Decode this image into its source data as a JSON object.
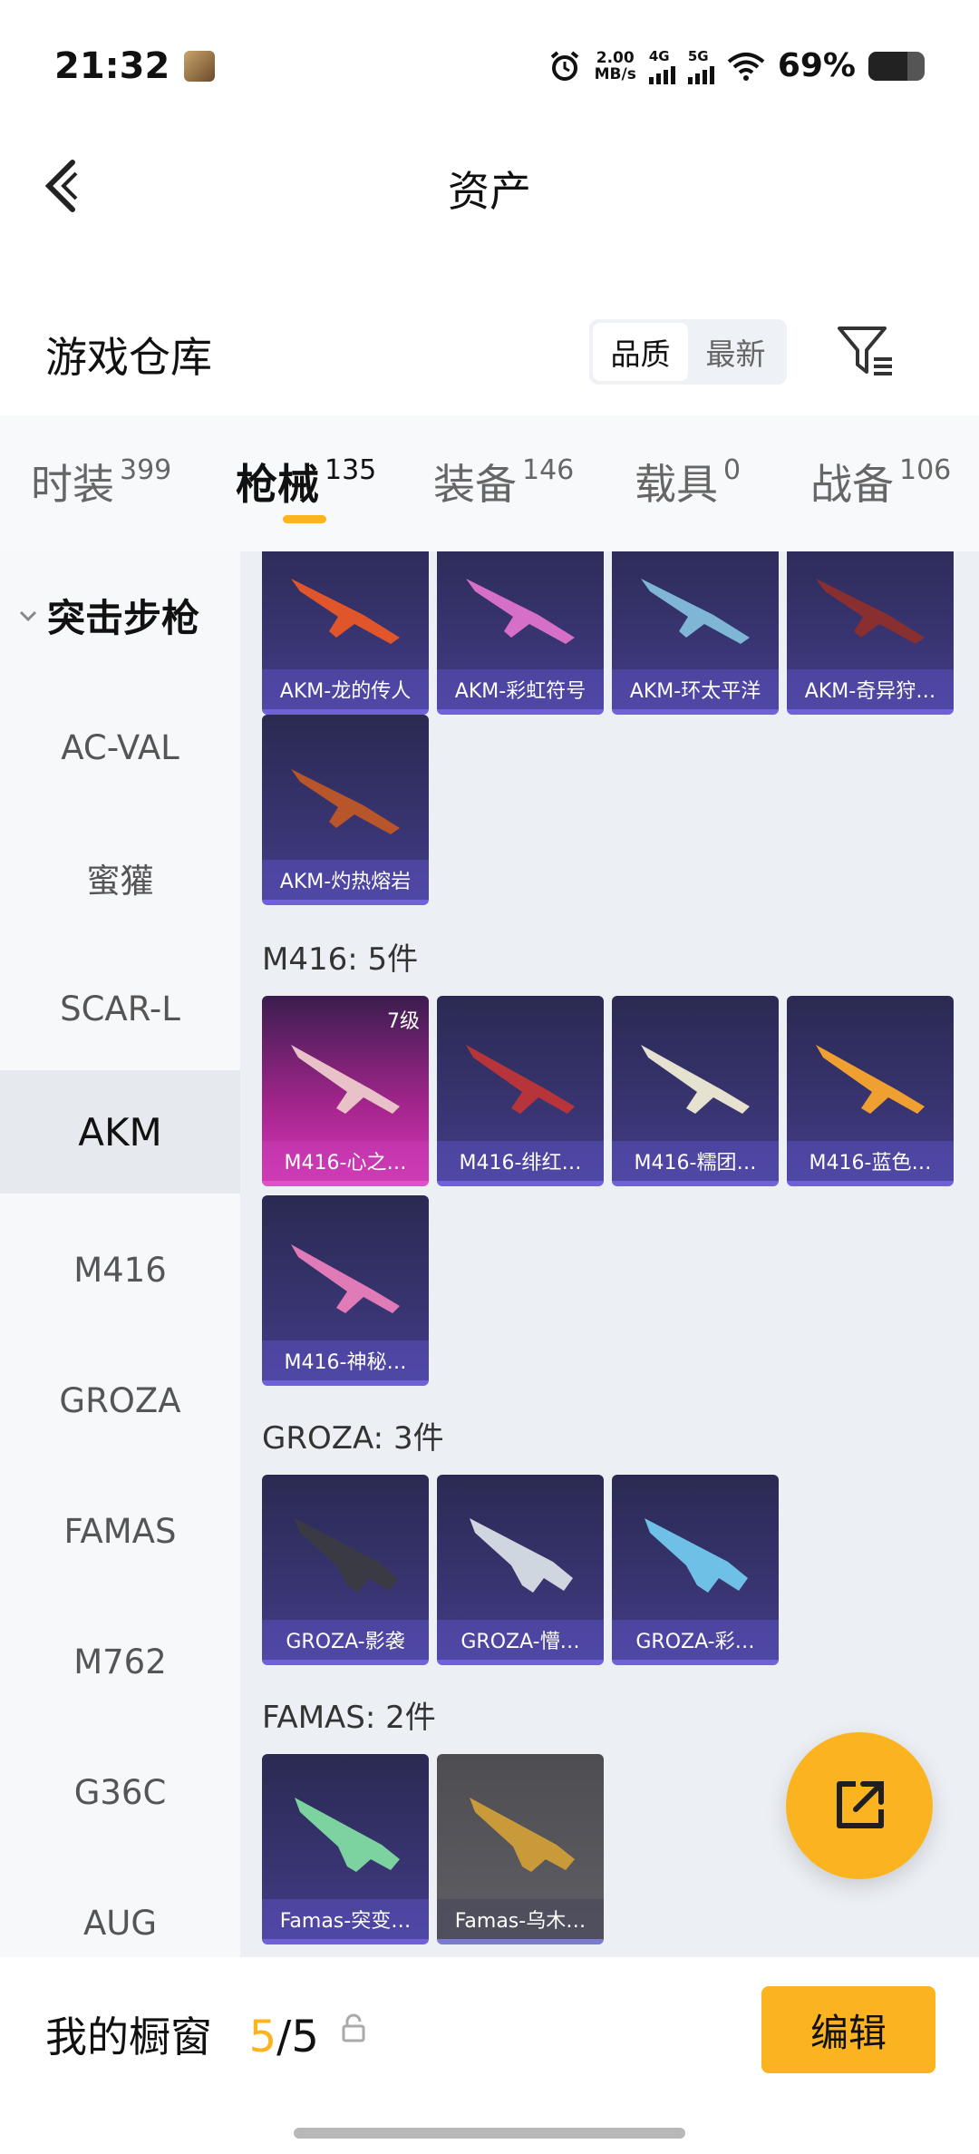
{
  "status_bar": {
    "time": "21:32",
    "net_rate": "2.00",
    "net_unit": "MB/s",
    "net1": "4G",
    "net2": "5G",
    "battery_text": "69%",
    "battery_level": 0.69,
    "icons": [
      "alarm-icon",
      "wifi-icon",
      "battery-icon"
    ]
  },
  "header": {
    "title": "资产",
    "back_icon": "chevron-left-icon"
  },
  "warehouse": {
    "title": "游戏仓库",
    "sort_options": [
      "品质",
      "最新"
    ],
    "sort_selected": "品质",
    "filter_icon": "filter-icon"
  },
  "tabs": [
    {
      "label": "时装",
      "count": "399"
    },
    {
      "label": "枪械",
      "count": "135",
      "active": true
    },
    {
      "label": "装备",
      "count": "146"
    },
    {
      "label": "载具",
      "count": "0"
    },
    {
      "label": "战备",
      "count": "106"
    }
  ],
  "sidebar": {
    "group": "突击步枪",
    "items": [
      "AC-VAL",
      "蜜獾",
      "SCAR-L",
      "AKM",
      "M416",
      "GROZA",
      "FAMAS",
      "M762",
      "G36C",
      "AUG"
    ],
    "active": "AKM"
  },
  "content": {
    "akm_cards": [
      "AKM-龙的传人",
      "AKM-彩虹符号",
      "AKM-环太平洋",
      "AKM-奇异狩…",
      "AKM-灼热熔岩"
    ],
    "m416_title": "M416: 5件",
    "m416_cards": [
      "M416-心之…",
      "M416-绯红…",
      "M416-糯团…",
      "M416-蓝色…",
      "M416-神秘…"
    ],
    "m416_level": "7级",
    "groza_title": "GROZA: 3件",
    "groza_cards": [
      "GROZA-影袭",
      "GROZA-懵…",
      "GROZA-彩…"
    ],
    "famas_title": "FAMAS: 2件",
    "famas_cards": [
      "Famas-突变…",
      "Famas-乌木…"
    ]
  },
  "fab": {
    "icon": "share-external-icon"
  },
  "bottom": {
    "showcase_label": "我的橱窗",
    "showcase_used": "5",
    "showcase_sep": "/",
    "showcase_total": "5",
    "lock_icon": "lock-icon",
    "edit_label": "编辑"
  },
  "colors": {
    "accent": "#fbb420",
    "card_purple": "#383471",
    "card_pink": "#d539b7",
    "card_gray": "#5e5e64"
  }
}
